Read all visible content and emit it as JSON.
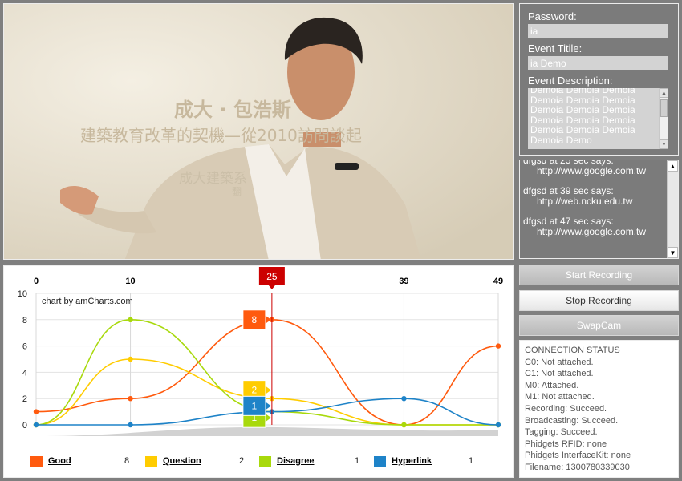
{
  "video": {
    "slide_lines": [
      "成大 · 包浩斯",
      "建築教育改革的契機—從2010訪問談起",
      "成大建築系",
      "翻"
    ]
  },
  "form": {
    "password_label": "Password:",
    "password_value": "ia",
    "event_title_label": "Event Titile:",
    "event_title_value": "ia Demo",
    "event_description_label": "Event Description:",
    "event_description_lines": [
      "Demoia Demoia Demoia",
      "Demoia Demoia Demoia",
      "Demoia Demoia Demoia",
      "Demoia Demoia Demoia",
      "Demoia Demoia Demoia",
      "Demoia Demo"
    ]
  },
  "chat": {
    "messages": [
      {
        "header": "dfgsd at 25 sec says:",
        "url": "http://www.google.com.tw"
      },
      {
        "header": "dfgsd at 39 sec says:",
        "url": "http://web.ncku.edu.tw"
      },
      {
        "header": "dfgsd at 47 sec says:",
        "url": "http://www.google.com.tw"
      }
    ]
  },
  "buttons": {
    "start_recording": "Start Recording",
    "stop_recording": "Stop Recording",
    "swapcam": "SwapCam"
  },
  "status": {
    "title": "CONNECTION STATUS",
    "lines": [
      "C0:  Not attached.",
      "C1:  Not attached.",
      "M0:  Attached.",
      "M1:  Not attached.",
      "Recording:  Succeed.",
      "Broadcasting: Succeed.",
      "Tagging:  Succeed.",
      "Phidgets RFID:  none",
      "Phidgets InterfaceKit:  none",
      "Filename:  1300780339030"
    ]
  },
  "chart_data": {
    "type": "line",
    "credit": "chart by amCharts.com",
    "ylim": [
      0,
      10
    ],
    "y_ticks": [
      0,
      2,
      4,
      6,
      8,
      10
    ],
    "top_x_labels": [
      "0",
      "10",
      "39",
      "49"
    ],
    "xlim": [
      0,
      49
    ],
    "cursor": {
      "x": 25,
      "label": "25"
    },
    "colors": {
      "Good": "#ff5a0e",
      "Question": "#ffcc00",
      "Disagree": "#a8d90c",
      "Hyperlink": "#1e83c8"
    },
    "series": [
      {
        "name": "Good",
        "points": [
          [
            0,
            1
          ],
          [
            10,
            2
          ],
          [
            25,
            8
          ],
          [
            39,
            0
          ],
          [
            49,
            6
          ]
        ],
        "legend_value": "8",
        "cursor_value": "8"
      },
      {
        "name": "Question",
        "points": [
          [
            0,
            0
          ],
          [
            10,
            5
          ],
          [
            25,
            2
          ],
          [
            39,
            0
          ],
          [
            49,
            0
          ]
        ],
        "legend_value": "2",
        "cursor_value": "2"
      },
      {
        "name": "Disagree",
        "points": [
          [
            0,
            0
          ],
          [
            10,
            8
          ],
          [
            25,
            1
          ],
          [
            39,
            0
          ],
          [
            49,
            0
          ]
        ],
        "legend_value": "1",
        "cursor_value": "1"
      },
      {
        "name": "Hyperlink",
        "points": [
          [
            0,
            0
          ],
          [
            10,
            0
          ],
          [
            25,
            1
          ],
          [
            39,
            2
          ],
          [
            49,
            0
          ]
        ],
        "legend_value": "1",
        "cursor_value": "1"
      }
    ]
  }
}
